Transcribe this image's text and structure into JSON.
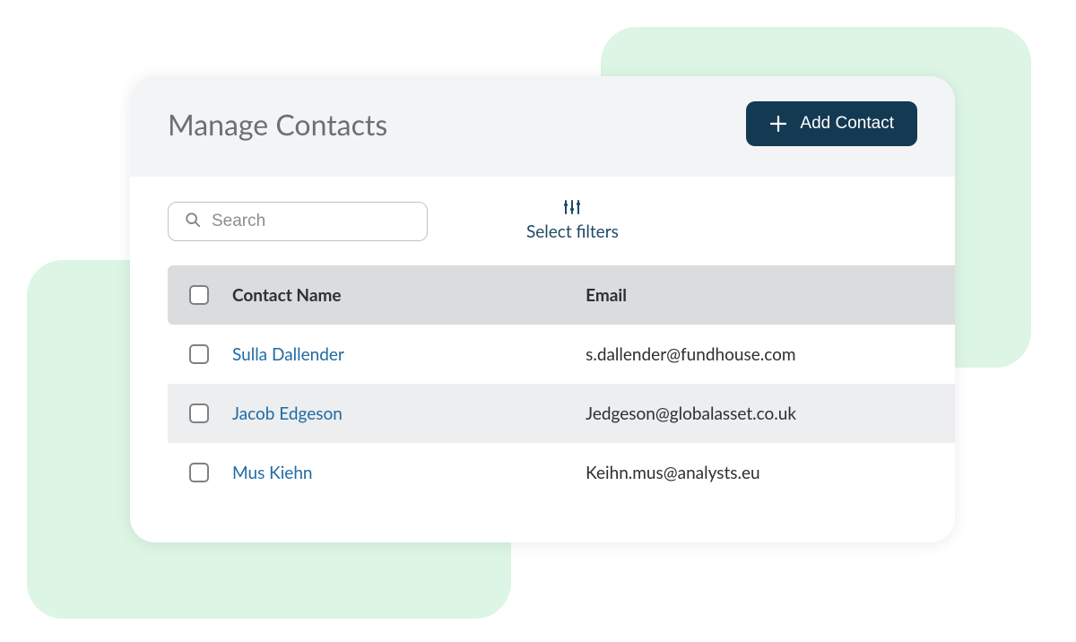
{
  "page": {
    "title": "Manage Contacts"
  },
  "buttons": {
    "add_contact": "Add Contact"
  },
  "search": {
    "placeholder": "Search"
  },
  "filters": {
    "label": "Select filters"
  },
  "table": {
    "columns": {
      "name": "Contact Name",
      "email": "Email"
    },
    "rows": [
      {
        "name": "Sulla Dallender",
        "email": "s.dallender@fundhouse.com"
      },
      {
        "name": "Jacob Edgeson",
        "email": "Jedgeson@globalasset.co.uk"
      },
      {
        "name": "Mus Kiehn",
        "email": "Keihn.mus@analysts.eu"
      }
    ]
  },
  "colors": {
    "accent_bg": "#dcf5e4",
    "primary_button": "#143953",
    "link": "#1f6aa5"
  }
}
